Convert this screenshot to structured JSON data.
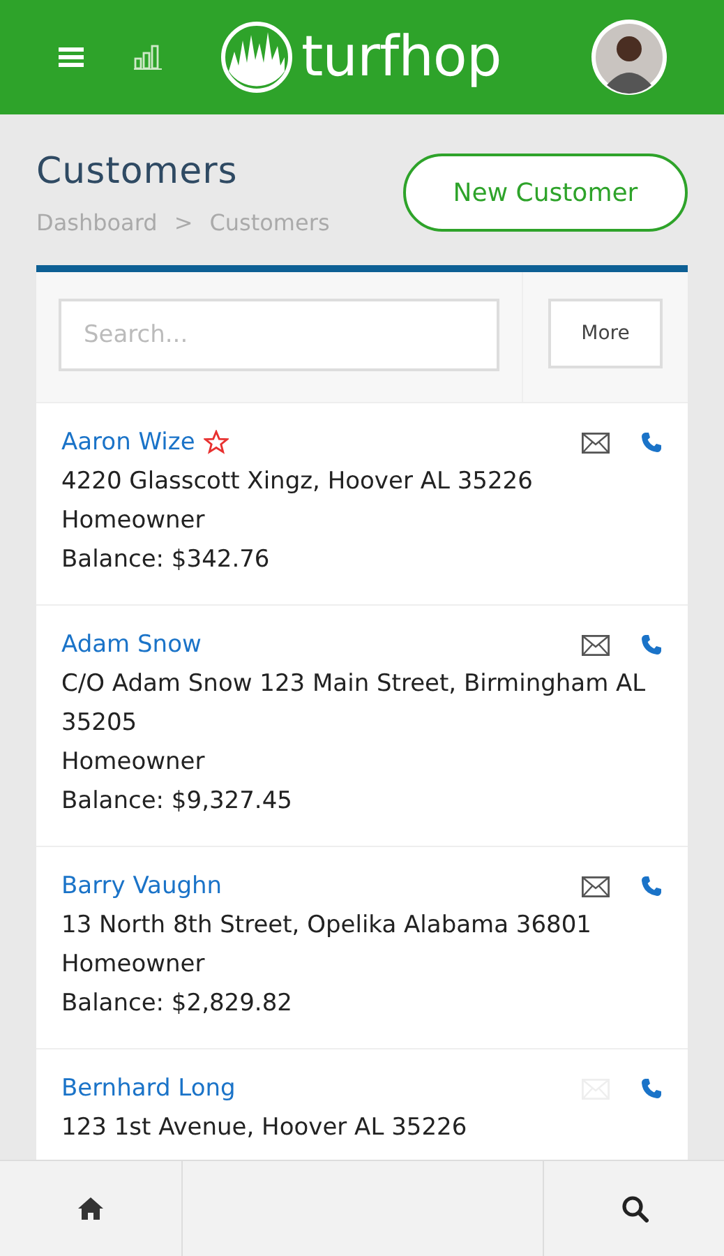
{
  "header": {
    "brand": "turfhop"
  },
  "page": {
    "title": "Customers",
    "breadcrumb": [
      "Dashboard",
      "Customers"
    ],
    "separator": ">",
    "new_button": "New Customer"
  },
  "search": {
    "placeholder": "Search...",
    "more_button": "More"
  },
  "customers": [
    {
      "name": "Aaron Wize",
      "starred": true,
      "address": "4220 Glasscott Xingz, Hoover AL 35226",
      "type": "Homeowner",
      "balance": "Balance: $342.76",
      "has_email": true
    },
    {
      "name": "Adam Snow",
      "starred": false,
      "address": "C/O Adam Snow 123 Main Street, Birmingham AL 35205",
      "type": "Homeowner",
      "balance": "Balance: $9,327.45",
      "has_email": true
    },
    {
      "name": "Barry Vaughn",
      "starred": false,
      "address": "13 North 8th Street, Opelika Alabama 36801",
      "type": "Homeowner",
      "balance": "Balance: $2,829.82",
      "has_email": true
    },
    {
      "name": "Bernhard Long",
      "starred": false,
      "address": "123 1st Avenue, Hoover AL 35226",
      "has_email": false
    }
  ]
}
